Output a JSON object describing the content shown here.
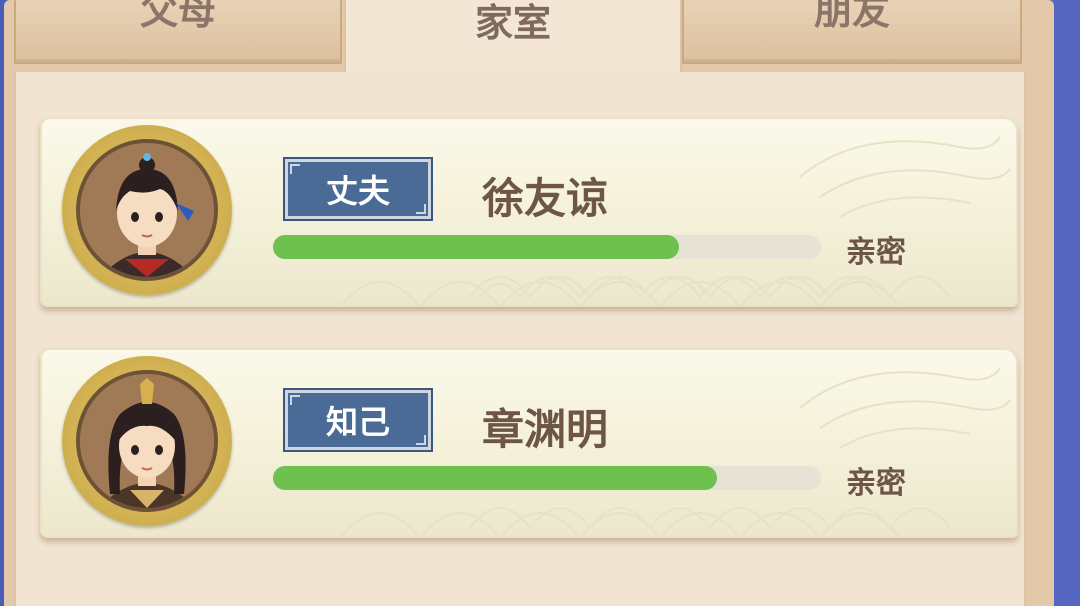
{
  "tabs": [
    {
      "label": "父母",
      "active": false
    },
    {
      "label": "家室",
      "active": true
    },
    {
      "label": "朋友",
      "active": false
    }
  ],
  "relations": [
    {
      "role": "丈夫",
      "name": "徐友谅",
      "intimacy_label": "亲密",
      "intimacy_progress": 0.74,
      "avatar": "male-avatar-icon"
    },
    {
      "role": "知己",
      "name": "章渊明",
      "intimacy_label": "亲密",
      "intimacy_progress": 0.81,
      "avatar": "female-avatar-icon"
    }
  ],
  "colors": {
    "badge": "#4a6b95",
    "progress": "#6ec04f",
    "card": "#fbf9ea",
    "frame": "#e3c9a9"
  }
}
